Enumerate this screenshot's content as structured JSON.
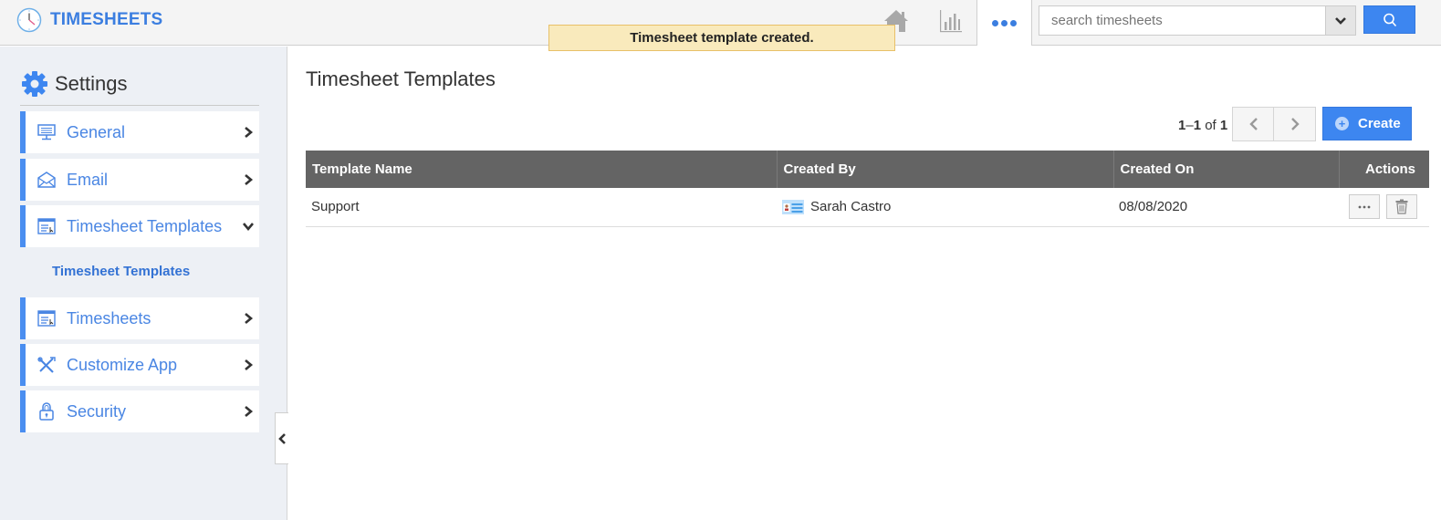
{
  "app": {
    "title": "TIMESHEETS",
    "brand_color": "#3b7ee0",
    "accent_color": "#3d86f0"
  },
  "topnav": {
    "icons": [
      "home-icon",
      "reports-icon",
      "more-icon"
    ],
    "search": {
      "placeholder": "search timesheets",
      "value": ""
    }
  },
  "toast": {
    "message": "Timesheet template created.",
    "bg_color": "#f9eabc"
  },
  "sidebar": {
    "title": "Settings",
    "items": [
      {
        "label": "General",
        "icon": "monitor-icon",
        "expanded": false
      },
      {
        "label": "Email",
        "icon": "envelope-icon",
        "expanded": false
      },
      {
        "label": "Timesheet Templates",
        "icon": "template-icon",
        "expanded": true,
        "subitems": [
          {
            "label": "Timesheet Templates",
            "active": true
          }
        ]
      },
      {
        "label": "Timesheets",
        "icon": "timesheet-icon",
        "expanded": false
      },
      {
        "label": "Customize App",
        "icon": "tools-icon",
        "expanded": false
      },
      {
        "label": "Security",
        "icon": "lock-icon",
        "expanded": false
      }
    ]
  },
  "main": {
    "title": "Timesheet Templates",
    "pager": {
      "from": "1",
      "to": "1",
      "of_label": "of",
      "total": "1"
    },
    "create_label": "Create",
    "table": {
      "columns": [
        "Template Name",
        "Created By",
        "Created On",
        "Actions"
      ],
      "rows": [
        {
          "name": "Support",
          "created_by": "Sarah Castro",
          "created_on": "08/08/2020"
        }
      ]
    }
  }
}
